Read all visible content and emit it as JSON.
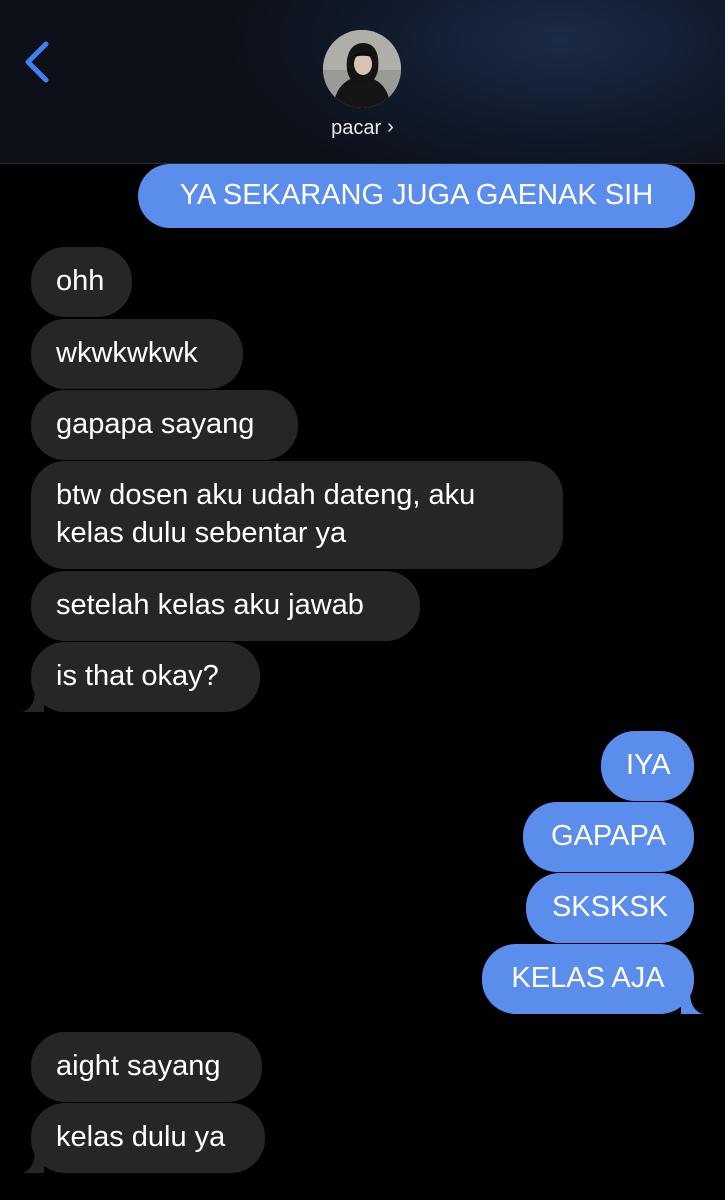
{
  "header": {
    "contact_name": "pacar",
    "chevron": "›",
    "back_icon": "chevron-left-icon",
    "colors": {
      "accent": "#3b82f6",
      "incoming_bubble": "#262628",
      "outgoing_bubble": "#5b8ded"
    }
  },
  "messages": [
    {
      "direction": "out",
      "text": "YA SEKARANG JUGA GAENAK SIH"
    },
    {
      "direction": "in",
      "text": "ohh"
    },
    {
      "direction": "in",
      "text": "wkwkwkwk"
    },
    {
      "direction": "in",
      "text": "gapapa sayang"
    },
    {
      "direction": "in",
      "lines": [
        "btw dosen aku udah dateng, aku",
        "kelas dulu sebentar ya"
      ]
    },
    {
      "direction": "in",
      "text": "setelah kelas aku jawab"
    },
    {
      "direction": "in",
      "text": "is that okay?"
    },
    {
      "direction": "out",
      "text": "IYA"
    },
    {
      "direction": "out",
      "text": "GAPAPA"
    },
    {
      "direction": "out",
      "text": "SKSKSK"
    },
    {
      "direction": "out",
      "text": "KELAS AJA"
    },
    {
      "direction": "in",
      "text": "aight sayang"
    },
    {
      "direction": "in",
      "text": "kelas dulu ya"
    }
  ]
}
